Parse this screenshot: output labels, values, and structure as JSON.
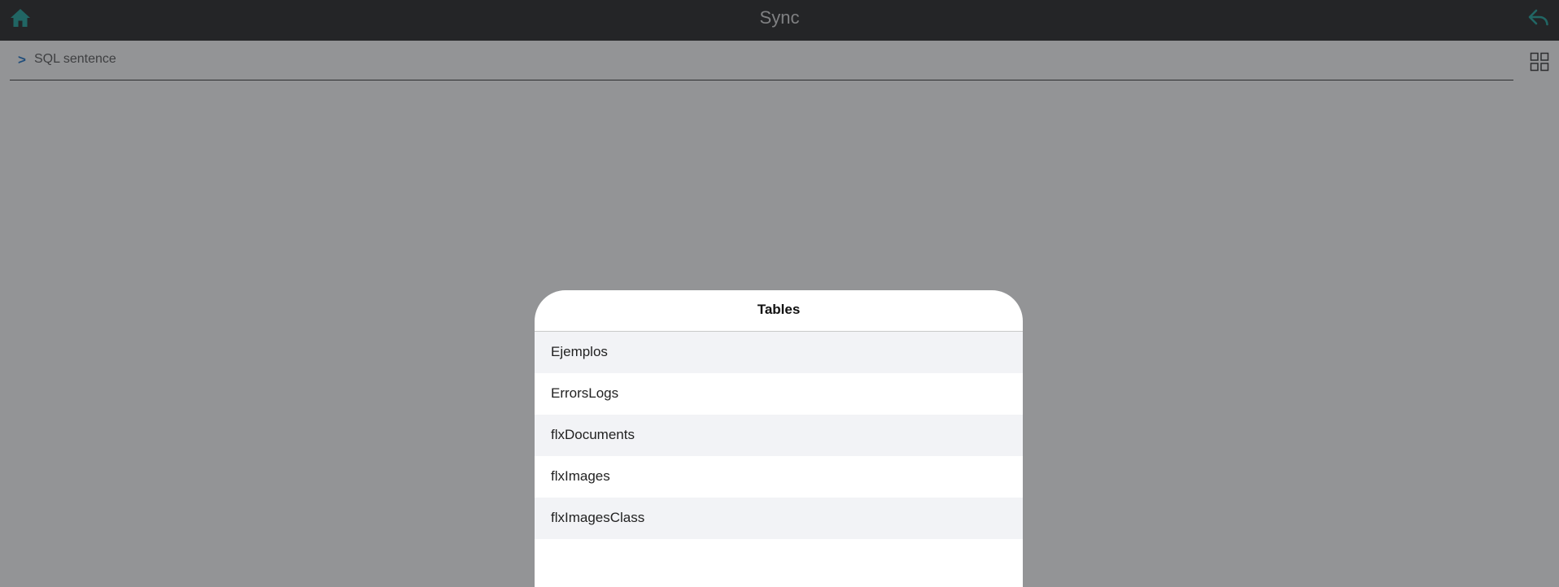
{
  "header": {
    "title": "Sync",
    "home_icon": "home-icon",
    "back_icon": "reply-arrow-icon",
    "accent_color": "#1aa39b"
  },
  "sql": {
    "prompt": ">",
    "placeholder": "SQL sentence",
    "grid_icon": "grid-view-icon"
  },
  "modal": {
    "title": "Tables",
    "items": [
      {
        "label": "Ejemplos"
      },
      {
        "label": "ErrorsLogs"
      },
      {
        "label": "flxDocuments"
      },
      {
        "label": "flxImages"
      },
      {
        "label": "flxImagesClass"
      }
    ]
  }
}
